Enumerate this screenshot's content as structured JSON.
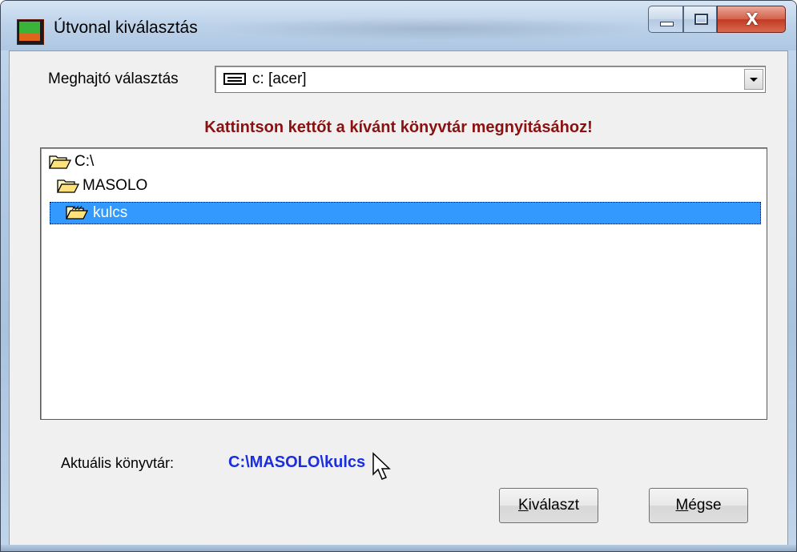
{
  "window": {
    "title": "Útvonal kiválasztás",
    "close_glyph": "X",
    "icons": {
      "app": "app-icon",
      "minimize": "minimize-icon",
      "maximize": "maximize-icon",
      "close": "close-icon"
    }
  },
  "drive": {
    "label": "Meghajtó választás",
    "selected": "c: [acer]",
    "icon": "drive-icon"
  },
  "instruction": "Kattintson kettőt a kívánt könyvtár megnyitásához!",
  "directories": [
    {
      "name": "C:\\",
      "icon": "open-folder-icon"
    },
    {
      "name": "MASOLO",
      "icon": "open-folder-icon"
    },
    {
      "name": "kulcs",
      "icon": "open-folder-icon",
      "selected": true
    }
  ],
  "current_dir": {
    "label": "Aktuális könyvtár:",
    "value": "C:\\MASOLO\\kulcs"
  },
  "buttons": {
    "select": {
      "mnemonic": "K",
      "rest": "iválaszt"
    },
    "cancel": {
      "mnemonic": "M",
      "rest": "égse"
    }
  },
  "colors": {
    "instruction": "#8b1010",
    "current_dir_value": "#1a2ee0",
    "selection": "#3399ff"
  }
}
